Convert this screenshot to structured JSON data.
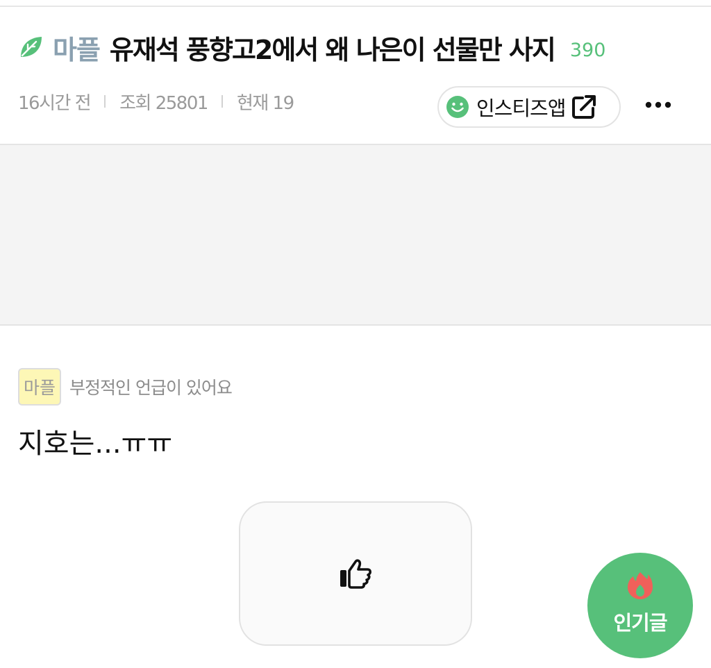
{
  "post": {
    "board": "마플",
    "title": "유재석 풍향고2에서 왜 나은이 선물만 사지",
    "comment_count": "390",
    "time": "16시간 전",
    "views": "조회 25801",
    "current": "현재 19",
    "app_button": "인스티즈앱",
    "tag": "마플",
    "tag_note": "부정적인 언급이 있어요",
    "body": "지호는...ㅠㅠ"
  },
  "fab": {
    "label": "인기글"
  },
  "icons": {
    "board": "leaf-icon",
    "app": "smile-icon",
    "external": "external-link-icon",
    "more": "more-icon",
    "like": "thumbs-up-icon",
    "fab": "fire-icon"
  },
  "colors": {
    "accent": "#57c07a",
    "board_name": "#8aa0b0",
    "tag_bg": "#fdf7b6",
    "fire": "#f0605a",
    "ad_bg": "#f4f4f4"
  }
}
